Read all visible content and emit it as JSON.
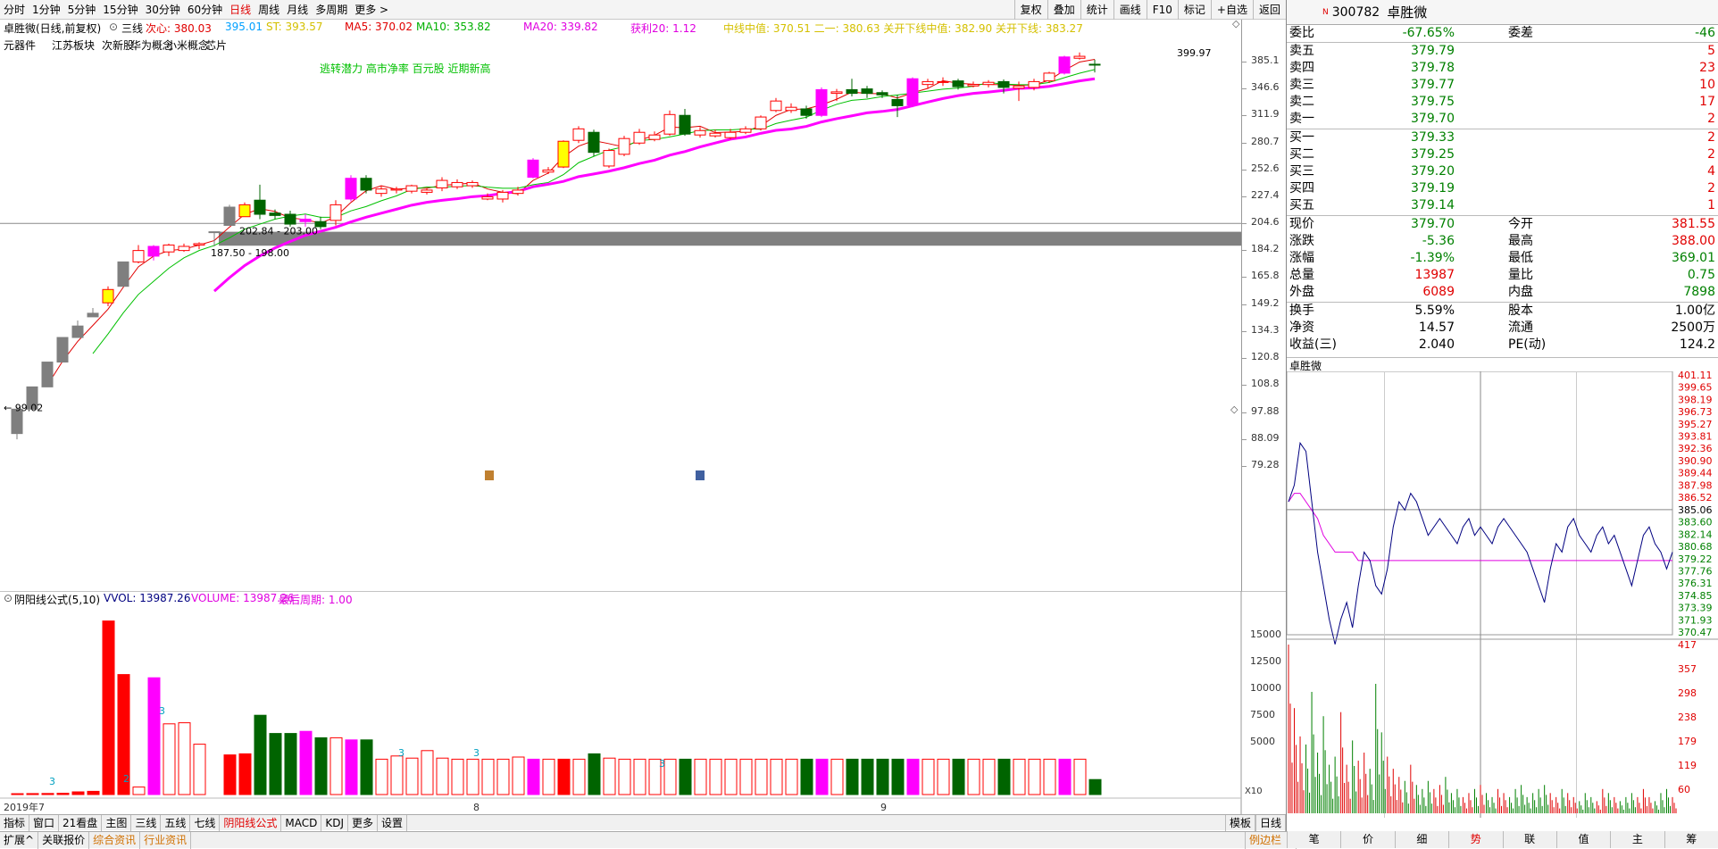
{
  "toolbar": {
    "periods": [
      "分时",
      "1分钟",
      "5分钟",
      "15分钟",
      "30分钟",
      "60分钟",
      "日线",
      "周线",
      "月线",
      "多周期",
      "更多 >"
    ],
    "active_period": "日线",
    "right": [
      "复权",
      "叠加",
      "统计",
      "画线",
      "F10",
      "标记",
      "+自选",
      "返回"
    ]
  },
  "info": {
    "stock_label": "卓胜微(日线,前复权)",
    "indicator": "三线",
    "xin": "次心: 380.03",
    "c1": "395.01",
    "st": "ST: 393.57",
    "ma5": "MA5: 370.02",
    "ma10": "MA10: 353.82",
    "ma20": "MA20: 339.82",
    "huoli": "获利20: 1.12",
    "cost": "中线中值: 370.51  二一: 380.63  关开下线中值: 382.90  关开下线: 383.27"
  },
  "tags": [
    "元器件",
    "江苏板块",
    "次新股",
    "华为概念",
    "小米概念",
    "芯片"
  ],
  "signal_text": "逃转潜力 高市净率 百元股 近期新高",
  "price_annotations": {
    "high": "399.97",
    "low": "99.02",
    "gap1": "202.84 - 203.00",
    "gap2": "187.50 - 198.00"
  },
  "price_axis": [
    "385.1",
    "346.6",
    "311.9",
    "280.7",
    "252.6",
    "227.4",
    "204.6",
    "184.2",
    "165.8",
    "149.2",
    "134.3",
    "120.8",
    "108.8",
    "97.88",
    "88.09",
    "79.28"
  ],
  "vol_head": {
    "title": "阴阳线公式(5,10)",
    "vvol": "VVOL: 13987.26",
    "volume": "VOLUME: 13987.26",
    "last": "最后周期: 1.00"
  },
  "vol_axis": [
    "15000",
    "12500",
    "10000",
    "7500",
    "5000"
  ],
  "vol_unit": "X10",
  "date_labels": {
    "d1": "2019年7",
    "d2": "8",
    "d3": "9"
  },
  "vol_marks": [
    "3",
    "2",
    "3",
    "3",
    "3",
    "3"
  ],
  "chart_data": {
    "type": "candlestick",
    "candles": [
      {
        "o": 90,
        "c": 99,
        "h": 100,
        "l": 88,
        "v": 80,
        "col": "gray"
      },
      {
        "o": 99,
        "c": 108,
        "h": 108,
        "l": 99,
        "v": 90,
        "col": "gray"
      },
      {
        "o": 108,
        "c": 119,
        "h": 119,
        "l": 108,
        "v": 100,
        "col": "gray"
      },
      {
        "o": 119,
        "c": 131,
        "h": 131,
        "l": 119,
        "v": 120,
        "col": "gray"
      },
      {
        "o": 131,
        "c": 137,
        "h": 140,
        "l": 131,
        "v": 250,
        "col": "gray"
      },
      {
        "o": 142,
        "c": 144,
        "h": 147,
        "l": 142,
        "v": 300,
        "col": "gray"
      },
      {
        "o": 150,
        "c": 158,
        "h": 160,
        "l": 148,
        "v": 16200,
        "col": "yellow"
      },
      {
        "o": 160,
        "c": 176,
        "h": 176,
        "l": 160,
        "v": 11200,
        "col": "gray"
      },
      {
        "o": 176,
        "c": 184,
        "h": 188,
        "l": 175,
        "v": 700,
        "col": "red"
      },
      {
        "o": 187,
        "c": 180,
        "h": 188,
        "l": 177,
        "v": 10900,
        "col": "magenta"
      },
      {
        "o": 183,
        "c": 188,
        "h": 189,
        "l": 180,
        "v": 6600,
        "col": "red"
      },
      {
        "o": 184,
        "c": 187,
        "h": 189,
        "l": 183,
        "v": 6700,
        "col": "red"
      },
      {
        "o": 188,
        "c": 189,
        "h": 190,
        "l": 185,
        "v": 4700,
        "col": "red"
      },
      {
        "o": 198,
        "c": 198,
        "h": 198,
        "l": 187,
        "v": 0,
        "col": "gray"
      },
      {
        "o": 203,
        "c": 218,
        "h": 220,
        "l": 203,
        "v": 3700,
        "col": "gray"
      },
      {
        "o": 210,
        "c": 220,
        "h": 222,
        "l": 210,
        "v": 3800,
        "col": "yellow"
      },
      {
        "o": 224,
        "c": 212,
        "h": 238,
        "l": 208,
        "v": 7400,
        "col": "green"
      },
      {
        "o": 213,
        "c": 211,
        "h": 216,
        "l": 208,
        "v": 5700,
        "col": "green"
      },
      {
        "o": 212,
        "c": 204,
        "h": 215,
        "l": 202,
        "v": 5700,
        "col": "green"
      },
      {
        "o": 206,
        "c": 208,
        "h": 212,
        "l": 202,
        "v": 5900,
        "col": "magenta"
      },
      {
        "o": 206,
        "c": 202,
        "h": 210,
        "l": 200,
        "v": 5300,
        "col": "green"
      },
      {
        "o": 207,
        "c": 220,
        "h": 224,
        "l": 203,
        "v": 5300,
        "col": "red"
      },
      {
        "o": 225,
        "c": 244,
        "h": 247,
        "l": 223,
        "v": 5100,
        "col": "magenta"
      },
      {
        "o": 244,
        "c": 233,
        "h": 247,
        "l": 230,
        "v": 5100,
        "col": "green"
      },
      {
        "o": 230,
        "c": 234,
        "h": 237,
        "l": 227,
        "v": 3300,
        "col": "red"
      },
      {
        "o": 233,
        "c": 234,
        "h": 236,
        "l": 230,
        "v": 3600,
        "col": "red"
      },
      {
        "o": 232,
        "c": 237,
        "h": 238,
        "l": 230,
        "v": 3400,
        "col": "red"
      },
      {
        "o": 231,
        "c": 233,
        "h": 235,
        "l": 229,
        "v": 4100,
        "col": "red"
      },
      {
        "o": 235,
        "c": 242,
        "h": 245,
        "l": 232,
        "v": 3400,
        "col": "red"
      },
      {
        "o": 236,
        "c": 240,
        "h": 243,
        "l": 234,
        "v": 3300,
        "col": "red"
      },
      {
        "o": 240,
        "c": 237,
        "h": 242,
        "l": 235,
        "v": 3300,
        "col": "red"
      },
      {
        "o": 227,
        "c": 225,
        "h": 230,
        "l": 224,
        "v": 3300,
        "col": "red"
      },
      {
        "o": 225,
        "c": 231,
        "h": 233,
        "l": 222,
        "v": 3300,
        "col": "red"
      },
      {
        "o": 230,
        "c": 233,
        "h": 236,
        "l": 228,
        "v": 3500,
        "col": "red"
      },
      {
        "o": 245,
        "c": 262,
        "h": 264,
        "l": 244,
        "v": 3300,
        "col": "magenta"
      },
      {
        "o": 250,
        "c": 252,
        "h": 255,
        "l": 248,
        "v": 3300,
        "col": "red"
      },
      {
        "o": 255,
        "c": 282,
        "h": 283,
        "l": 254,
        "v": 3300,
        "col": "yellow"
      },
      {
        "o": 283,
        "c": 296,
        "h": 299,
        "l": 280,
        "v": 3300,
        "col": "red"
      },
      {
        "o": 292,
        "c": 270,
        "h": 295,
        "l": 266,
        "v": 3800,
        "col": "green"
      },
      {
        "o": 256,
        "c": 272,
        "h": 274,
        "l": 254,
        "v": 3400,
        "col": "red"
      },
      {
        "o": 268,
        "c": 285,
        "h": 288,
        "l": 266,
        "v": 3300,
        "col": "red"
      },
      {
        "o": 280,
        "c": 292,
        "h": 296,
        "l": 278,
        "v": 3300,
        "col": "red"
      },
      {
        "o": 284,
        "c": 289,
        "h": 293,
        "l": 282,
        "v": 3300,
        "col": "red"
      },
      {
        "o": 290,
        "c": 313,
        "h": 318,
        "l": 288,
        "v": 3300,
        "col": "red"
      },
      {
        "o": 312,
        "c": 290,
        "h": 320,
        "l": 288,
        "v": 3300,
        "col": "green"
      },
      {
        "o": 289,
        "c": 294,
        "h": 298,
        "l": 286,
        "v": 3300,
        "col": "red"
      },
      {
        "o": 288,
        "c": 291,
        "h": 295,
        "l": 286,
        "v": 3300,
        "col": "red"
      },
      {
        "o": 286,
        "c": 292,
        "h": 296,
        "l": 284,
        "v": 3300,
        "col": "red"
      },
      {
        "o": 292,
        "c": 296,
        "h": 299,
        "l": 290,
        "v": 3300,
        "col": "red"
      },
      {
        "o": 296,
        "c": 310,
        "h": 312,
        "l": 294,
        "v": 3300,
        "col": "red"
      },
      {
        "o": 318,
        "c": 330,
        "h": 334,
        "l": 316,
        "v": 3300,
        "col": "red"
      },
      {
        "o": 322,
        "c": 318,
        "h": 327,
        "l": 315,
        "v": 3300,
        "col": "red"
      },
      {
        "o": 320,
        "c": 312,
        "h": 324,
        "l": 308,
        "v": 3300,
        "col": "green"
      },
      {
        "o": 312,
        "c": 345,
        "h": 348,
        "l": 310,
        "v": 3300,
        "col": "magenta"
      },
      {
        "o": 342,
        "c": 340,
        "h": 346,
        "l": 330,
        "v": 3300,
        "col": "red"
      },
      {
        "o": 345,
        "c": 340,
        "h": 360,
        "l": 336,
        "v": 3300,
        "col": "green"
      },
      {
        "o": 346,
        "c": 340,
        "h": 350,
        "l": 334,
        "v": 3300,
        "col": "green"
      },
      {
        "o": 341,
        "c": 338,
        "h": 344,
        "l": 334,
        "v": 3300,
        "col": "green"
      },
      {
        "o": 332,
        "c": 324,
        "h": 338,
        "l": 310,
        "v": 3300,
        "col": "green"
      },
      {
        "o": 325,
        "c": 360,
        "h": 362,
        "l": 322,
        "v": 3300,
        "col": "magenta"
      },
      {
        "o": 352,
        "c": 356,
        "h": 360,
        "l": 346,
        "v": 3300,
        "col": "red"
      },
      {
        "o": 355,
        "c": 356,
        "h": 362,
        "l": 350,
        "v": 3300,
        "col": "red"
      },
      {
        "o": 357,
        "c": 349,
        "h": 360,
        "l": 345,
        "v": 3300,
        "col": "green"
      },
      {
        "o": 350,
        "c": 352,
        "h": 356,
        "l": 348,
        "v": 3300,
        "col": "red"
      },
      {
        "o": 352,
        "c": 355,
        "h": 358,
        "l": 348,
        "v": 3300,
        "col": "red"
      },
      {
        "o": 356,
        "c": 348,
        "h": 359,
        "l": 340,
        "v": 3300,
        "col": "green"
      },
      {
        "o": 347,
        "c": 350,
        "h": 356,
        "l": 330,
        "v": 3300,
        "col": "red"
      },
      {
        "o": 348,
        "c": 356,
        "h": 360,
        "l": 344,
        "v": 3300,
        "col": "red"
      },
      {
        "o": 357,
        "c": 368,
        "h": 370,
        "l": 354,
        "v": 3300,
        "col": "red"
      },
      {
        "o": 368,
        "c": 392,
        "h": 394,
        "l": 366,
        "v": 3300,
        "col": "magenta"
      },
      {
        "o": 390,
        "c": 393,
        "h": 399,
        "l": 388,
        "v": 3300,
        "col": "red"
      },
      {
        "o": 381,
        "c": 380,
        "h": 388,
        "l": 369,
        "v": 1399,
        "col": "green"
      }
    ],
    "ylim": [
      79.28,
      400
    ]
  },
  "intraday": {
    "title": "卓胜微",
    "price_labels_red": [
      "401.11",
      "399.65",
      "398.19",
      "396.73",
      "395.27",
      "393.81",
      "392.36",
      "390.90",
      "389.44",
      "387.98",
      "386.52"
    ],
    "price_mid": "385.06",
    "price_labels_green": [
      "383.60",
      "382.14",
      "380.68",
      "379.22",
      "377.76",
      "376.31",
      "374.85",
      "373.39",
      "371.93",
      "370.47"
    ],
    "vol_labels": [
      "417",
      "357",
      "298",
      "238",
      "179",
      "119",
      "60"
    ],
    "yclose": 385.06,
    "ylim": [
      370.47,
      401.11
    ],
    "prices": [
      386,
      388,
      393,
      392,
      386,
      380,
      376,
      372,
      369,
      372,
      374,
      371,
      376,
      380,
      379,
      376,
      375,
      378,
      383,
      386,
      385,
      387,
      386,
      384,
      382,
      383,
      384,
      383,
      382,
      381,
      383,
      384,
      382,
      383,
      382,
      381,
      383,
      384,
      383,
      382,
      381,
      380,
      378,
      376,
      374,
      378,
      381,
      380,
      383,
      384,
      382,
      381,
      380,
      382,
      383,
      381,
      382,
      380,
      378,
      376,
      379,
      382,
      383,
      381,
      380,
      378,
      380
    ],
    "avg": [
      386,
      387,
      387,
      386,
      385,
      384,
      382,
      381,
      380,
      380,
      380,
      380,
      379,
      379,
      379,
      379,
      379,
      379,
      379,
      379,
      379,
      379,
      379,
      379,
      379,
      379,
      379,
      379,
      379,
      379,
      379,
      379,
      379,
      379,
      379,
      379,
      379,
      379,
      379,
      379,
      379,
      379,
      379,
      379,
      379,
      379,
      379,
      379,
      379,
      379,
      379,
      379,
      379,
      379,
      379,
      379,
      379,
      379,
      379,
      379,
      379,
      379,
      379,
      379,
      379,
      379,
      379
    ],
    "vol": [
      417,
      260,
      190,
      170,
      300,
      150,
      240,
      120,
      140,
      250,
      120,
      180,
      130,
      150,
      110,
      320,
      200,
      140,
      110,
      90,
      80,
      120,
      70,
      60,
      80,
      60,
      70,
      90,
      50,
      60,
      40,
      50,
      60,
      70,
      50,
      40,
      60,
      50,
      40,
      60,
      70,
      40,
      50,
      60,
      70,
      50,
      40,
      60,
      50,
      40,
      30,
      50,
      40,
      30,
      60,
      50,
      40,
      30,
      40,
      50,
      40,
      60,
      40,
      30,
      50,
      60,
      40
    ]
  },
  "quote": {
    "weibi_label": "委比",
    "weibi": "-67.65%",
    "weicha_label": "委差",
    "weicha": "-46",
    "sell": [
      {
        "label": "卖五",
        "price": "379.79",
        "qty": "5"
      },
      {
        "label": "卖四",
        "price": "379.78",
        "qty": "23"
      },
      {
        "label": "卖三",
        "price": "379.77",
        "qty": "10"
      },
      {
        "label": "卖二",
        "price": "379.75",
        "qty": "17"
      },
      {
        "label": "卖一",
        "price": "379.70",
        "qty": "2"
      }
    ],
    "buy": [
      {
        "label": "买一",
        "price": "379.33",
        "qty": "2"
      },
      {
        "label": "买二",
        "price": "379.25",
        "qty": "2"
      },
      {
        "label": "买三",
        "price": "379.20",
        "qty": "4"
      },
      {
        "label": "买四",
        "price": "379.19",
        "qty": "2"
      },
      {
        "label": "买五",
        "price": "379.14",
        "qty": "1"
      }
    ],
    "stats": [
      {
        "l1": "现价",
        "v1": "379.70",
        "c1": "green",
        "l2": "今开",
        "v2": "381.55",
        "c2": "red"
      },
      {
        "l1": "涨跌",
        "v1": "-5.36",
        "c1": "green",
        "l2": "最高",
        "v2": "388.00",
        "c2": "red"
      },
      {
        "l1": "涨幅",
        "v1": "-1.39%",
        "c1": "green",
        "l2": "最低",
        "v2": "369.01",
        "c2": "green"
      },
      {
        "l1": "总量",
        "v1": "13987",
        "c1": "red",
        "l2": "量比",
        "v2": "0.75",
        "c2": "green"
      },
      {
        "l1": "外盘",
        "v1": "6089",
        "c1": "red",
        "l2": "内盘",
        "v2": "7898",
        "c2": "green"
      }
    ],
    "fund": [
      {
        "l1": "换手",
        "v1": "5.59%",
        "l2": "股本",
        "v2": "1.00亿"
      },
      {
        "l1": "净资",
        "v1": "14.57",
        "l2": "流通",
        "v2": "2500万"
      },
      {
        "l1": "收益(三)",
        "v1": "2.040",
        "l2": "PE(动)",
        "v2": "124.2"
      }
    ]
  },
  "stock": {
    "badge": "N",
    "code": "300782",
    "name": "卓胜微"
  },
  "bottom_tabs": [
    "指标",
    "窗口",
    "21看盘",
    "主图",
    "三线",
    "五线",
    "七线",
    "阴阳线公式",
    "MACD",
    "KDJ",
    "更多",
    "设置"
  ],
  "active_bottom": "阴阳线公式",
  "bottom_right": [
    "模板",
    "日线"
  ],
  "status": [
    "扩展^",
    "关联报价",
    "综合资讯",
    "行业资讯"
  ],
  "status_right": "例边栏《",
  "rt_tabs": [
    "笔",
    "价",
    "细",
    "势",
    "联",
    "值",
    "主",
    "筹"
  ],
  "active_rt": "势"
}
